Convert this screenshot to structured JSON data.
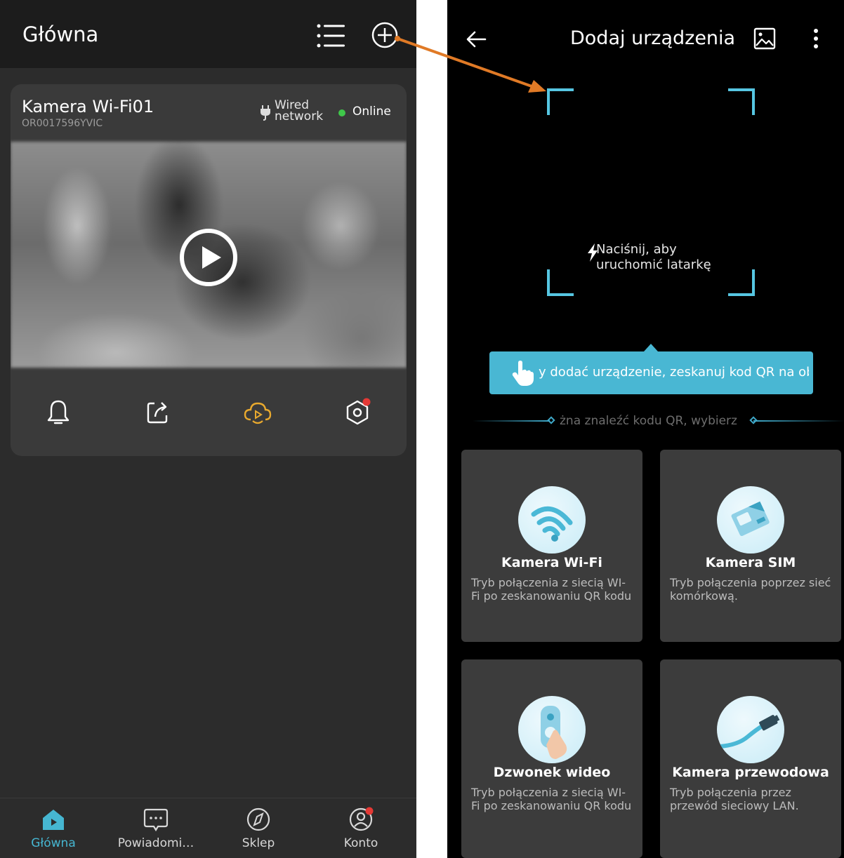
{
  "left": {
    "header": {
      "title": "Główna"
    },
    "device": {
      "name": "Kamera Wi-Fi01",
      "id": "OR0017596YVIC",
      "connection_line1": "Wired",
      "connection_line2": "network",
      "status": "Online"
    },
    "actions": [
      "bell-icon",
      "share-icon",
      "cloud-playback-icon",
      "settings-icon"
    ],
    "nav": [
      {
        "label": "Główna",
        "icon": "home-icon",
        "active": true
      },
      {
        "label": "Powiadomi…",
        "icon": "message-icon",
        "active": false
      },
      {
        "label": "Sklep",
        "icon": "compass-icon",
        "active": false
      },
      {
        "label": "Konto",
        "icon": "account-icon",
        "active": false
      }
    ]
  },
  "right": {
    "header": {
      "title": "Dodaj urządzenia"
    },
    "flashlight_line1": "Naciśnij, aby",
    "flashlight_line2": "uruchomić latarkę",
    "tooltip_text": "y dodać urządzenie, zeskanuj kod QR na obudc",
    "divider_text": "żna znaleźć kodu QR, wybierz",
    "tiles": [
      {
        "title": "Kamera Wi-Fi",
        "desc": "Tryb połączenia z siecią WI-Fi po zeskanowaniu QR kodu"
      },
      {
        "title": "Kamera SIM",
        "desc": "Tryb połączenia poprzez sieć komórkową."
      },
      {
        "title": "Dzwonek wideo",
        "desc": "Tryb połączenia z siecią WI-Fi po zeskanowaniu QR kodu"
      },
      {
        "title": "Kamera przewodowa",
        "desc": "Tryb połączenia przez przewód sieciowy LAN."
      }
    ]
  },
  "colors": {
    "accent": "#46b6d1",
    "online": "#3fc74a",
    "annotation_arrow": "#e07a26",
    "cloud_icon": "#e8a92e",
    "badge": "#e53935"
  }
}
